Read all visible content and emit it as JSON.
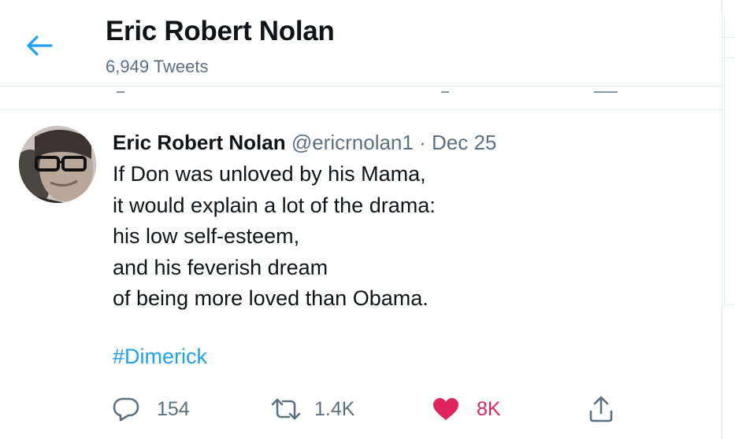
{
  "header": {
    "title": "Eric Robert Nolan",
    "subtitle": "6,949 Tweets",
    "back_icon": "arrow-left-icon"
  },
  "tweet": {
    "author_name": "Eric Robert Nolan",
    "handle": "@ericrnolan1",
    "separator": "·",
    "date": "Dec 25",
    "lines": [
      "If Don was unloved by his Mama,",
      "it would explain a lot of the drama:",
      "his low self-esteem,",
      "and his feverish dream",
      "of being more loved than Obama."
    ],
    "hashtag": "#Dimerick",
    "actions": {
      "reply": {
        "icon": "reply-icon",
        "count": "154"
      },
      "retweet": {
        "icon": "retweet-icon",
        "count": "1.4K"
      },
      "like": {
        "icon": "heart-icon",
        "count": "8K",
        "liked": true
      },
      "share": {
        "icon": "share-icon"
      }
    }
  },
  "colors": {
    "accent": "#1da1f2",
    "like": "#e0245e",
    "secondary_text": "#5b7083",
    "border": "#e6ecf0"
  }
}
